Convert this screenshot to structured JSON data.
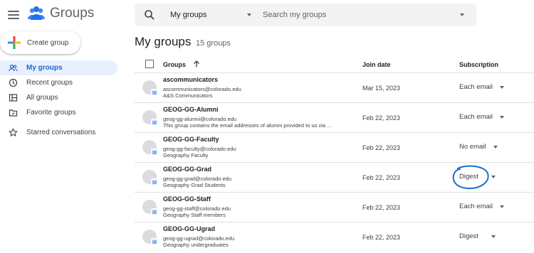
{
  "app": {
    "title": "Groups"
  },
  "sidebar": {
    "create_label": "Create group",
    "items": [
      {
        "label": "My groups",
        "icon": "people-outline-icon",
        "active": true
      },
      {
        "label": "Recent groups",
        "icon": "clock-icon"
      },
      {
        "label": "All groups",
        "icon": "all-groups-icon"
      },
      {
        "label": "Favorite groups",
        "icon": "folder-icon"
      },
      {
        "label": "Starred conversations",
        "icon": "star-icon"
      }
    ]
  },
  "search": {
    "scope": "My groups",
    "placeholder": "Search my groups"
  },
  "page": {
    "title": "My groups",
    "count": "15 groups"
  },
  "table": {
    "headers": {
      "groups": "Groups",
      "join_date": "Join date",
      "subscription": "Subscription"
    },
    "rows": [
      {
        "name": "ascommunicators",
        "email": "ascommunicators@colorado.edu",
        "desc": "A&S Communicators",
        "join": "Mar 15, 2023",
        "sub": "Each email"
      },
      {
        "name": "GEOG-GG-Alumni",
        "email": "geog-gg-alumni@colorado.edu",
        "desc": "This group contains the email addresses of alumni provided to us via ...",
        "join": "Feb 22, 2023",
        "sub": "Each email"
      },
      {
        "name": "GEOG-GG-Faculty",
        "email": "geog-gg-faculty@colorado.edu",
        "desc": "Geography Faculty",
        "join": "Feb 22, 2023",
        "sub": "No email"
      },
      {
        "name": "GEOG-GG-Grad",
        "email": "geog-gg-grad@colorado.edu",
        "desc": "Geography Grad Students",
        "join": "Feb 22, 2023",
        "sub": "Digest"
      },
      {
        "name": "GEOG-GG-Staff",
        "email": "geog-gg-staff@colorado.edu",
        "desc": "Geography Staff members",
        "join": "Feb 22, 2023",
        "sub": "Each email"
      },
      {
        "name": "GEOG-GG-Ugrad",
        "email": "geog-gg-ugrad@colorado.edu",
        "desc": "Geography undergraduates",
        "join": "Feb 22, 2023",
        "sub": "Digest"
      }
    ]
  },
  "colors": {
    "accent": "#1967d2",
    "active_bg": "#e8f0fe",
    "annotation": "#1a6fd1"
  }
}
